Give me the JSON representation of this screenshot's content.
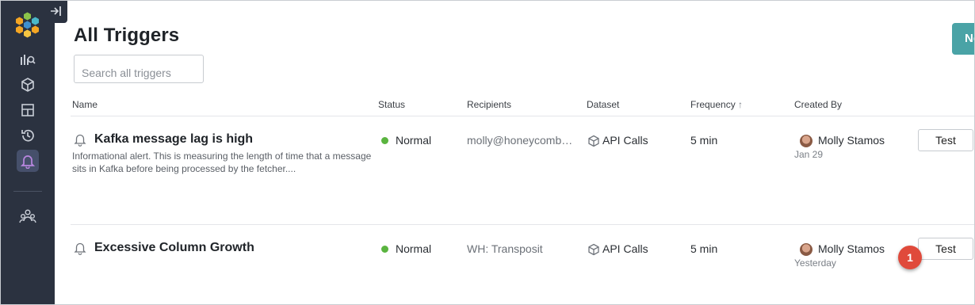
{
  "page": {
    "title": "All Triggers"
  },
  "toolbar": {
    "new_label": "Ne"
  },
  "search": {
    "placeholder": "Search all triggers"
  },
  "table": {
    "headers": {
      "name": "Name",
      "status": "Status",
      "recipients": "Recipients",
      "dataset": "Dataset",
      "frequency": "Frequency",
      "created_by": "Created By"
    },
    "sort_indicator": "↑",
    "rows": [
      {
        "name": "Kafka message lag is high",
        "description": "Informational alert. This is measuring the length of time that a message sits in Kafka before being processed by the fetcher....",
        "status": "Normal",
        "recipients": "molly@honeycomb…",
        "dataset": "API Calls",
        "frequency": "5 min",
        "creator": "Molly Stamos",
        "created": "Jan 29",
        "test_label": "Test"
      },
      {
        "name": "Excessive Column Growth",
        "description": "",
        "status": "Normal",
        "recipients": "WH: Transposit",
        "dataset": "API Calls",
        "frequency": "5 min",
        "creator": "Molly Stamos",
        "created": "Yesterday",
        "test_label": "Test"
      }
    ]
  },
  "annotation": {
    "badge": "1"
  },
  "colors": {
    "sidebar": "#2b3240",
    "accent": "#4aa3a6",
    "status_normal": "#5ab43f",
    "active_nav": "#b987e0",
    "badge": "#e04a3b"
  },
  "sidebar_icons": [
    "query-icon",
    "dataset-icon",
    "board-icon",
    "history-icon",
    "triggers-bell-icon",
    "team-icon"
  ]
}
